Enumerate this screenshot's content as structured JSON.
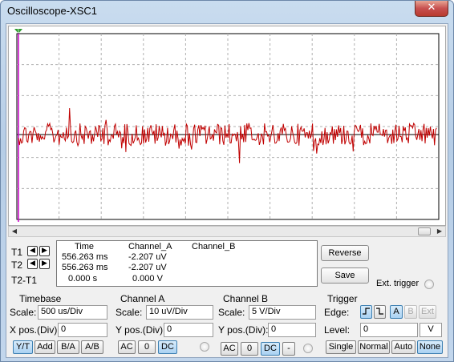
{
  "window": {
    "title": "Oscilloscope-XSC1",
    "close_label": "✕"
  },
  "colors": {
    "trace_a": "#c00000",
    "marker_t1": "#cc00cc",
    "grid": "#b0b0b0",
    "active_button": "#a9d1f2"
  },
  "cursors": {
    "t1_label": "T1",
    "t2_label": "T2",
    "delta_label": "T2-T1",
    "headers": {
      "time": "Time",
      "channel_a": "Channel_A",
      "channel_b": "Channel_B"
    },
    "rows": [
      {
        "time": "556.263 ms",
        "channel_a": "-2.207 uV",
        "channel_b": ""
      },
      {
        "time": "556.263 ms",
        "channel_a": "-2.207 uV",
        "channel_b": ""
      },
      {
        "time": "0.000 s",
        "channel_a": "0.000 V",
        "channel_b": ""
      }
    ],
    "reverse_label": "Reverse",
    "save_label": "Save",
    "ext_trigger_label": "Ext. trigger"
  },
  "timebase": {
    "title": "Timebase",
    "scale_label": "Scale:",
    "scale_value": "500 us/Div",
    "xpos_label": "X pos.(Div):",
    "xpos_value": "0",
    "buttons": [
      "Y/T",
      "Add",
      "B/A",
      "A/B"
    ]
  },
  "channel_a": {
    "title": "Channel A",
    "scale_label": "Scale:",
    "scale_value": "10 uV/Div",
    "ypos_label": "Y pos.(Div):",
    "ypos_value": "0",
    "coupling": [
      "AC",
      "0",
      "DC"
    ]
  },
  "channel_b": {
    "title": "Channel B",
    "scale_label": "Scale:",
    "scale_value": "5  V/Div",
    "ypos_label": "Y pos.(Div):",
    "ypos_value": "0",
    "coupling": [
      "AC",
      "0",
      "DC",
      "-"
    ]
  },
  "trigger": {
    "title": "Trigger",
    "edge_label": "Edge:",
    "edge_buttons": [
      "A",
      "B",
      "Ext"
    ],
    "level_label": "Level:",
    "level_value": "0",
    "level_unit": "V",
    "mode_buttons": [
      "Single",
      "Normal",
      "Auto",
      "None"
    ]
  }
}
